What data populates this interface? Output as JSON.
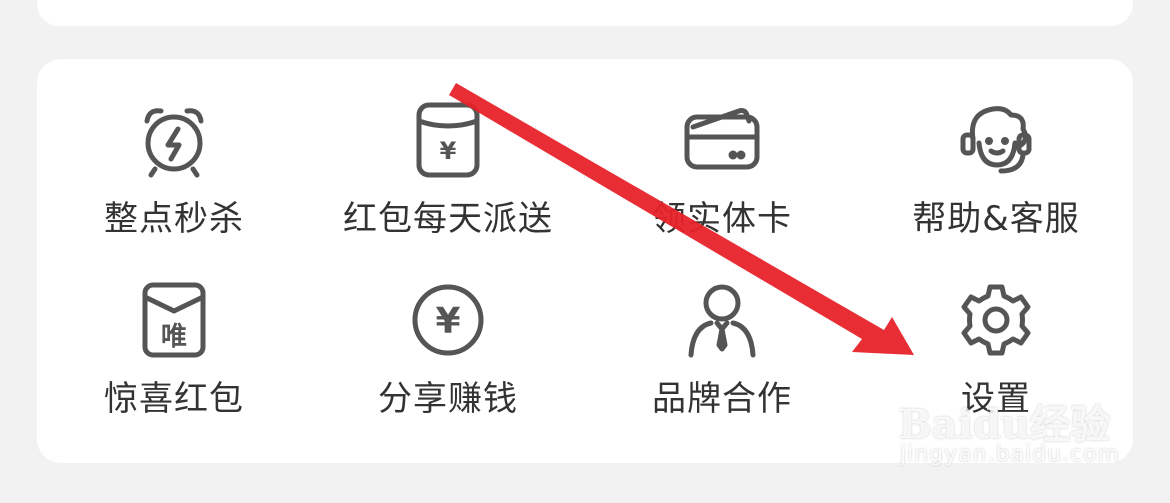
{
  "menu": {
    "items": [
      {
        "label": "整点秒杀",
        "icon": "flash-alarm-clock-icon"
      },
      {
        "label": "红包每天派送",
        "icon": "yuan-jar-icon"
      },
      {
        "label": "领实体卡",
        "icon": "card-wallet-icon"
      },
      {
        "label": "帮助&客服",
        "icon": "customer-service-headset-icon"
      },
      {
        "label": "惊喜红包",
        "icon": "red-envelope-wei-icon"
      },
      {
        "label": "分享赚钱",
        "icon": "yuan-coin-icon"
      },
      {
        "label": "品牌合作",
        "icon": "business-person-icon"
      },
      {
        "label": "设置",
        "icon": "gear-icon"
      }
    ]
  },
  "icon_glyphs": {
    "yuan": "¥",
    "wei": "唯"
  },
  "watermark": {
    "brand": "Baidu经验",
    "url": "jingyan.baidu.com"
  },
  "colors": {
    "icon_stroke": "#555555",
    "label_text": "#333333",
    "arrow": "#e8222a",
    "card_bg": "#ffffff",
    "page_bg": "#f2f2f2"
  }
}
